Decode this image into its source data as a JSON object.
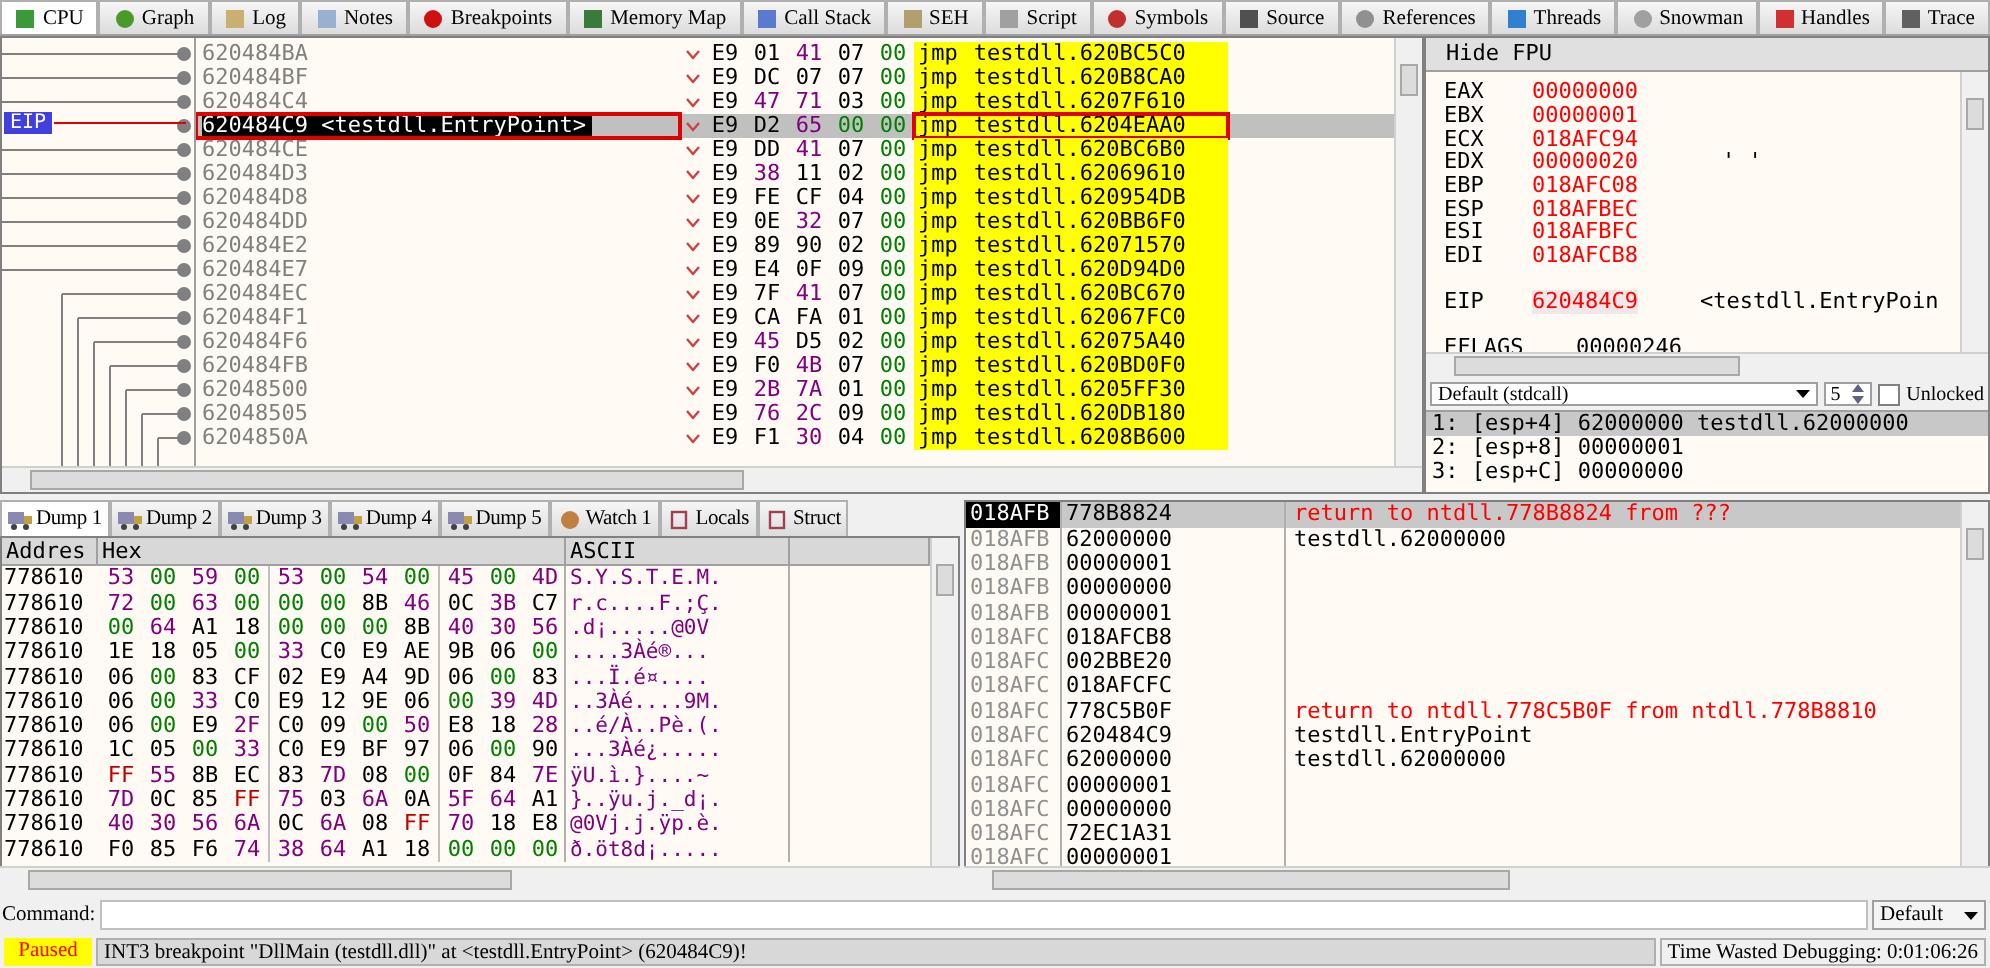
{
  "tabs": [
    {
      "label": "CPU",
      "selected": true
    },
    {
      "label": "Graph",
      "selected": false
    },
    {
      "label": "Log",
      "selected": false
    },
    {
      "label": "Notes",
      "selected": false
    },
    {
      "label": "Breakpoints",
      "selected": false
    },
    {
      "label": "Memory Map",
      "selected": false
    },
    {
      "label": "Call Stack",
      "selected": false
    },
    {
      "label": "SEH",
      "selected": false
    },
    {
      "label": "Script",
      "selected": false
    },
    {
      "label": "Symbols",
      "selected": false
    },
    {
      "label": "Source",
      "selected": false
    },
    {
      "label": "References",
      "selected": false
    },
    {
      "label": "Threads",
      "selected": false
    },
    {
      "label": "Snowman",
      "selected": false
    },
    {
      "label": "Handles",
      "selected": false
    },
    {
      "label": "Trace",
      "selected": false
    }
  ],
  "disassembly": {
    "eip_label": "EIP",
    "rows": [
      {
        "address": "620484BA",
        "bytes": "E9 01 41 07 00",
        "mnemonic": "jmp",
        "operand": "testdll.620BC5C0",
        "selected": false
      },
      {
        "address": "620484BF",
        "bytes": "E9 DC 07 07 00",
        "mnemonic": "jmp",
        "operand": "testdll.620B8CA0",
        "selected": false
      },
      {
        "address": "620484C4",
        "bytes": "E9 47 71 03 00",
        "mnemonic": "jmp",
        "operand": "testdll.6207F610",
        "selected": false
      },
      {
        "address": "620484C9",
        "label": "<testdll.EntryPoint>",
        "bytes": "E9 D2 65 00 00",
        "mnemonic": "jmp",
        "operand": "testdll.6204EAA0",
        "selected": true
      },
      {
        "address": "620484CE",
        "bytes": "E9 DD 41 07 00",
        "mnemonic": "jmp",
        "operand": "testdll.620BC6B0",
        "selected": false
      },
      {
        "address": "620484D3",
        "bytes": "E9 38 11 02 00",
        "mnemonic": "jmp",
        "operand": "testdll.62069610",
        "selected": false
      },
      {
        "address": "620484D8",
        "bytes": "E9 FE CF 04 00",
        "mnemonic": "jmp",
        "operand": "testdll.620954DB",
        "selected": false
      },
      {
        "address": "620484DD",
        "bytes": "E9 0E 32 07 00",
        "mnemonic": "jmp",
        "operand": "testdll.620BB6F0",
        "selected": false
      },
      {
        "address": "620484E2",
        "bytes": "E9 89 90 02 00",
        "mnemonic": "jmp",
        "operand": "testdll.62071570",
        "selected": false
      },
      {
        "address": "620484E7",
        "bytes": "E9 E4 0F 09 00",
        "mnemonic": "jmp",
        "operand": "testdll.620D94D0",
        "selected": false
      },
      {
        "address": "620484EC",
        "bytes": "E9 7F 41 07 00",
        "mnemonic": "jmp",
        "operand": "testdll.620BC670",
        "selected": false
      },
      {
        "address": "620484F1",
        "bytes": "E9 CA FA 01 00",
        "mnemonic": "jmp",
        "operand": "testdll.62067FC0",
        "selected": false
      },
      {
        "address": "620484F6",
        "bytes": "E9 45 D5 02 00",
        "mnemonic": "jmp",
        "operand": "testdll.62075A40",
        "selected": false
      },
      {
        "address": "620484FB",
        "bytes": "E9 F0 4B 07 00",
        "mnemonic": "jmp",
        "operand": "testdll.620BD0F0",
        "selected": false
      },
      {
        "address": "62048500",
        "bytes": "E9 2B 7A 01 00",
        "mnemonic": "jmp",
        "operand": "testdll.6205FF30",
        "selected": false
      },
      {
        "address": "62048505",
        "bytes": "E9 76 2C 09 00",
        "mnemonic": "jmp",
        "operand": "testdll.620DB180",
        "selected": false
      },
      {
        "address": "6204850A",
        "bytes": "E9 F1 30 04 00",
        "mnemonic": "jmp",
        "operand": "testdll.6208B600",
        "selected": false
      }
    ]
  },
  "registers": {
    "header": "Hide FPU",
    "general": [
      {
        "name": "EAX",
        "value": "00000000",
        "changed": true
      },
      {
        "name": "EBX",
        "value": "00000001",
        "changed": true
      },
      {
        "name": "ECX",
        "value": "018AFC94",
        "changed": true
      },
      {
        "name": "EDX",
        "value": "00000020",
        "changed": true,
        "comment": "' '"
      },
      {
        "name": "EBP",
        "value": "018AFC08",
        "changed": true
      },
      {
        "name": "ESP",
        "value": "018AFBEC",
        "changed": true
      },
      {
        "name": "ESI",
        "value": "018AFBFC",
        "changed": true
      },
      {
        "name": "EDI",
        "value": "018AFCB8",
        "changed": true
      }
    ],
    "eip": {
      "name": "EIP",
      "value": "620484C9",
      "changed": true,
      "comment": "<testdll.EntryPoin"
    },
    "eflags": {
      "name": "EFLAGS",
      "value": "00000246"
    }
  },
  "call_convention": {
    "convention": "Default (stdcall)",
    "count": "5",
    "unlocked_label": "Unlocked",
    "unlocked": false,
    "args": [
      {
        "text": "1: [esp+4] 62000000 testdll.62000000",
        "selected": true
      },
      {
        "text": "2: [esp+8] 00000001",
        "selected": false
      },
      {
        "text": "3: [esp+C] 00000000",
        "selected": false
      }
    ]
  },
  "dump_tabs": [
    {
      "label": "Dump 1",
      "selected": true
    },
    {
      "label": "Dump 2",
      "selected": false
    },
    {
      "label": "Dump 3",
      "selected": false
    },
    {
      "label": "Dump 4",
      "selected": false
    },
    {
      "label": "Dump 5",
      "selected": false
    },
    {
      "label": "Watch 1",
      "selected": false
    },
    {
      "label": "Locals",
      "selected": false
    },
    {
      "label": "Struct",
      "selected": false
    }
  ],
  "dump": {
    "columns": [
      "Addres",
      "Hex",
      "ASCII"
    ],
    "rows": [
      {
        "address": "778610",
        "hex": "53 00 59 00 53 00 54 00 45 00 4D",
        "ascii": "S.Y.S.T.E.M."
      },
      {
        "address": "778610",
        "hex": "72 00 63 00 00 00 8B 46 0C 3B C7",
        "ascii": "r.c....F.;Ç."
      },
      {
        "address": "778610",
        "hex": "00 64 A1 18 00 00 00 8B 40 30 56",
        "ascii": ".d¡.....@0V"
      },
      {
        "address": "778610",
        "hex": "1E 18 05 00 33 C0 E9 AE 9B 06 00",
        "ascii": "....3Àé®..."
      },
      {
        "address": "778610",
        "hex": "06 00 83 CF 02 E9 A4 9D 06 00 83",
        "ascii": "...Ï.é¤...."
      },
      {
        "address": "778610",
        "hex": "06 00 33 C0 E9 12 9E 06 00 39 4D",
        "ascii": "..3Àé....9M."
      },
      {
        "address": "778610",
        "hex": "06 00 E9 2F C0 09 00 50 E8 18 28",
        "ascii": "..é/À..Pè.(."
      },
      {
        "address": "778610",
        "hex": "1C 05 00 33 C0 E9 BF 97 06 00 90",
        "ascii": "...3Àé¿....."
      },
      {
        "address": "778610",
        "hex": "FF 55 8B EC 83 7D 08 00 0F 84 7E",
        "ascii": "ÿU.ì.}....~"
      },
      {
        "address": "778610",
        "hex": "7D 0C 85 FF 75 03 6A 0A 5F 64 A1",
        "ascii": "}..ÿu.j._d¡."
      },
      {
        "address": "778610",
        "hex": "40 30 56 6A 0C 6A 08 FF 70 18 E8",
        "ascii": "@0Vj.j.ÿp.è."
      },
      {
        "address": "778610",
        "hex": "F0 85 F6 74 38 64 A1 18 00 00 00",
        "ascii": "ð.öt8d¡....."
      }
    ]
  },
  "stack": {
    "rows": [
      {
        "address": "018AFB",
        "value": "778B8824",
        "kind": "return",
        "comment": "return to ntdll.778B8824 from ???",
        "selected": true
      },
      {
        "address": "018AFB",
        "value": "62000000",
        "kind": "plain",
        "comment": "testdll.62000000",
        "selected": false
      },
      {
        "address": "018AFB",
        "value": "00000001",
        "selected": false
      },
      {
        "address": "018AFB",
        "value": "00000000",
        "selected": false
      },
      {
        "address": "018AFB",
        "value": "00000001",
        "selected": false
      },
      {
        "address": "018AFC",
        "value": "018AFCB8",
        "selected": false
      },
      {
        "address": "018AFC",
        "value": "002BBE20",
        "selected": false
      },
      {
        "address": "018AFC",
        "value": "018AFCFC",
        "selected": false
      },
      {
        "address": "018AFC",
        "value": "778C5B0F",
        "kind": "return",
        "comment": "return to ntdll.778C5B0F from ntdll.778B8810",
        "selected": false
      },
      {
        "address": "018AFC",
        "value": "620484C9",
        "kind": "plain",
        "comment": "testdll.EntryPoint",
        "selected": false
      },
      {
        "address": "018AFC",
        "value": "62000000",
        "kind": "plain",
        "comment": "testdll.62000000",
        "selected": false
      },
      {
        "address": "018AFC",
        "value": "00000001",
        "selected": false
      },
      {
        "address": "018AFC",
        "value": "00000000",
        "selected": false
      },
      {
        "address": "018AFC",
        "value": "72EC1A31",
        "selected": false
      },
      {
        "address": "018AFC",
        "value": "00000001",
        "selected": false
      }
    ]
  },
  "command": {
    "label": "Command:",
    "mode": "Default"
  },
  "status": {
    "state": "Paused",
    "message": "INT3 breakpoint \"DllMain (testdll.dll)\" at <testdll.EntryPoint> (620484C9)!",
    "timer": "Time Wasted Debugging: 0:01:06:26"
  }
}
